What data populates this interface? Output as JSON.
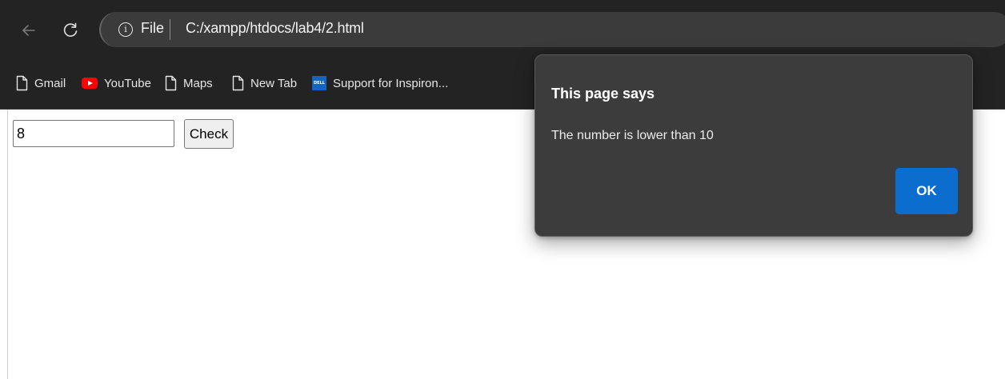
{
  "browser": {
    "file_label": "File",
    "url": "C:/xampp/htdocs/lab4/2.html"
  },
  "bookmarks": [
    {
      "label": "Gmail",
      "icon": "page-icon"
    },
    {
      "label": "YouTube",
      "icon": "youtube-icon"
    },
    {
      "label": "Maps",
      "icon": "page-icon"
    },
    {
      "label": "New Tab",
      "icon": "page-icon"
    },
    {
      "label": "Support for Inspiron...",
      "icon": "dell-icon"
    }
  ],
  "dell_logo_text": "DELL",
  "form": {
    "number_value": "8",
    "check_label": "Check"
  },
  "dialog": {
    "title": "This page says",
    "message": "The number is lower than 10",
    "ok_label": "OK"
  },
  "colors": {
    "toolbar": "#232323",
    "dialog_bg": "#3c3c3c",
    "ok_button": "#0b6ecf",
    "youtube_red": "#ff0000",
    "dell_blue": "#1565c0"
  }
}
